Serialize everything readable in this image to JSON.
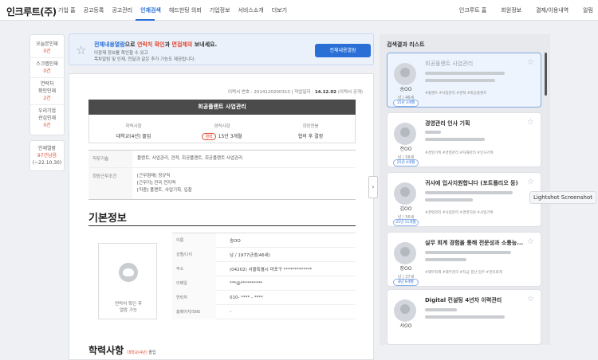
{
  "nav": {
    "logo": "인크루트(주)",
    "links": [
      "기업 홈",
      "공고등록",
      "공고관리",
      "인재검색",
      "헤드헌팅 의뢰",
      "기업정보",
      "서비스소개",
      "더보기"
    ],
    "right": [
      "인크루트 홈",
      "회원정보",
      "결제/이용내역",
      "알림"
    ]
  },
  "rail": {
    "items": [
      {
        "label": "오늘본인재",
        "count": "0건"
      },
      {
        "label": "스크랩인재",
        "count": "0건"
      },
      {
        "label": "연락처\n확인인재",
        "count": "2건"
      },
      {
        "label": "우리기업\n관심인재",
        "count": "0건"
      }
    ],
    "free_label": "인재열람",
    "free_count": "97건남음",
    "free_date": "(~22.10.30)"
  },
  "notice": {
    "prefix": "전체내용열람",
    "mid1": "으로 ",
    "red1": "연락처 확인",
    "mid2": "과 ",
    "red2": "면접제의",
    "suffix": " 보내세요.",
    "line2": "이광재 정보를 확인할 수 있고",
    "line3": "목차알림 및 인재, 전달과 같은 추가 기능도 제공됩니다.",
    "button": "전체내용열람"
  },
  "resume": {
    "meta_label": "이력서 번호 : 2014120200310",
    "meta_date_label": "  |  작업일자 : ",
    "meta_date": "14.12.02",
    "meta_suffix": " (이력서 공개)",
    "title": "회공플랜트 사업관리",
    "info": [
      {
        "k": "학력사항",
        "v": "대학교(4년) 졸업"
      },
      {
        "k": "경력사항",
        "badge": "경력",
        "v": "15년 3개월"
      },
      {
        "k": "희망연봉",
        "v": "협의 후 결정"
      }
    ],
    "job_rows": [
      {
        "k": "직무기술",
        "v": "플랜트, 사업관리, 견적, 회공플랜트, 회공플랜트 사업관리"
      },
      {
        "k": "희망근무조건",
        "v": "[근무형태] 정규직\n[근무지] 전국 전지역\n[직종] 플랜트, 사업기획, 입찰"
      }
    ],
    "section_title": "기본정보",
    "photo_caption": "연락처 확인 후\n열람 가능",
    "profile": [
      {
        "k": "이름",
        "v": "송OO"
      },
      {
        "k": "성별/나이",
        "v": "남 / 1977년생(46세)"
      },
      {
        "k": "주소",
        "v": "(04202) 서울특별시 마포구 *************"
      },
      {
        "k": "이메일",
        "v": "***@**********"
      },
      {
        "k": "연락처",
        "v": "010- **** - ****"
      },
      {
        "k": "홈페이지/SNS",
        "v": "-"
      }
    ],
    "section2_title": "학력사항",
    "section2_note_red": "대학교(4년)",
    "section2_note": " 졸업"
  },
  "panel": {
    "title": "검색결과 리스트",
    "cards": [
      {
        "title": "회공플랜트 사업관리",
        "name": "송OO",
        "age": "남 | 46세",
        "years": "15년 3개월",
        "tags": "#플랜트  #사업관리  #견적  #회공플랜트"
      },
      {
        "title": "경영관리 인사 기획",
        "name": "전OO",
        "age": "남 | 58세",
        "years": "25년 4개월",
        "tags": "#경영기획  #경영관리  #자재관리  #인사기획"
      },
      {
        "title": "귀사에 입사지원합니다 (포트폴리오 등)",
        "name": "김OO",
        "age": "남 | 56세",
        "years": "21년 11개월",
        "tags": "#경영관리  #사업관리  #경영지원  #사업기획"
      },
      {
        "title": "실무 회계 경험을 통해 전문성과 소통능...",
        "name": "장OO",
        "age": "남 | 37세",
        "years": "8년 9개월",
        "tags": "#재무회계  #재무관리  #자금 결산 업무  #관리회계"
      },
      {
        "title": "Digital 컨설팅 4년차 이력관리",
        "name": "서OO",
        "age": "",
        "years": "",
        "tags": ""
      }
    ]
  },
  "tooltip": "Lightshot Screenshot"
}
